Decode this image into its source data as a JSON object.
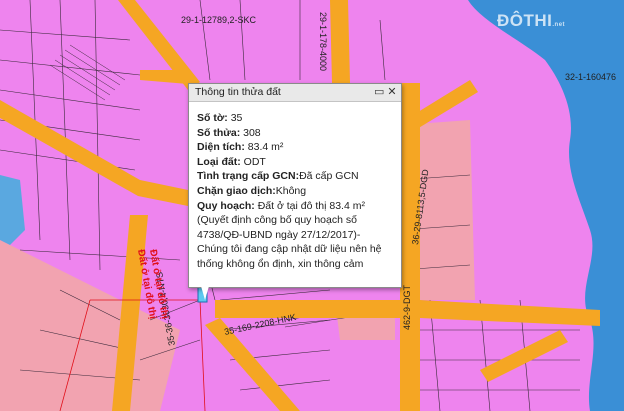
{
  "map": {
    "labels": {
      "parcel_top": "29-1-12789,2-SKC",
      "road_top_right": "29-1-178-4000",
      "parcel_right": "32-1-160476",
      "road_diag_right": "36-29-8113,5-DGD",
      "road_bottom_mid": "35-169-2208-HNK",
      "road_bottom_right": "462-9-DGT",
      "road_bottom_left": "35-36-3030,4-NTS",
      "red_line_1": "Đất ở tại đô thị",
      "red_line_2": "Đất ở tại đô thị"
    },
    "watermark": "ĐÔTHI",
    "watermark_suffix": ".net"
  },
  "popup": {
    "title": "Thông tin thửa đất",
    "fields": [
      {
        "label": "Số tờ:",
        "value": "35"
      },
      {
        "label": "Số thửa:",
        "value": "308"
      },
      {
        "label": "Diện tích:",
        "value": "83.4 m²"
      },
      {
        "label": "Loại đất:",
        "value": "ODT"
      },
      {
        "label": "Tình trạng cấp GCN:",
        "value": "Đã cấp GCN"
      },
      {
        "label": "Chặn giao dịch:",
        "value": "Không"
      },
      {
        "label": "Quy hoạch:",
        "value": "Đất ở tại đô thị 83.4 m²"
      }
    ],
    "note": "(Quyết định công bố quy hoạch số 4738/QĐ-UBND ngày 27/12/2017)- Chúng tôi đang cập nhật dữ liệu nên hệ thống không ổn định, xin thông cảm"
  },
  "colors": {
    "residential": "#ee84ee",
    "road": "#f5a623",
    "water": "#3a8fd6",
    "pink_land": "#f2a3b0",
    "parcel_line": "#3a2a3a"
  }
}
